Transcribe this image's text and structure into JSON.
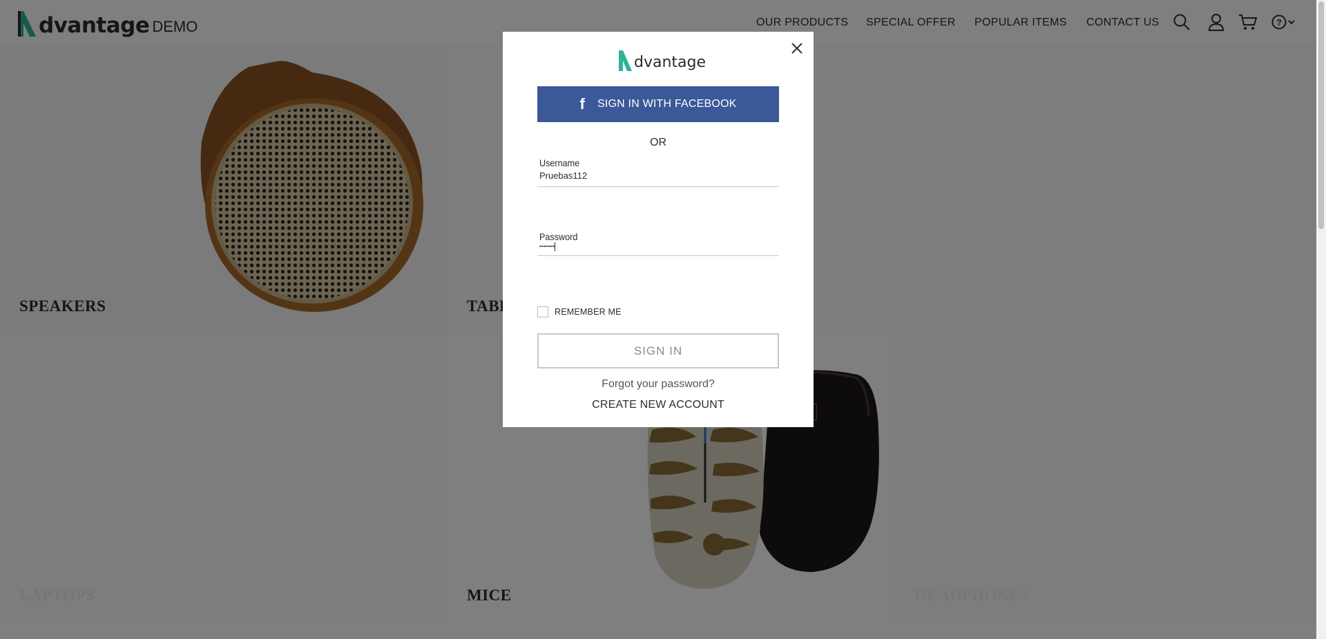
{
  "header": {
    "logo_text": "dvantage",
    "logo_suffix": "DEMO",
    "nav": [
      {
        "label": "OUR PRODUCTS"
      },
      {
        "label": "SPECIAL OFFER"
      },
      {
        "label": "POPULAR ITEMS"
      },
      {
        "label": "CONTACT US"
      }
    ],
    "icons": [
      "search-icon",
      "user-icon",
      "cart-icon",
      "help-icon",
      "chevron-down-icon"
    ]
  },
  "categories": {
    "speakers": "SPEAKERS",
    "tablets": "TABLETS",
    "laptops": "LAPTOPS",
    "mice": "MICE",
    "headphones": "HEADPHONES"
  },
  "login": {
    "logo_text": "dvantage",
    "facebook_label": "SIGN IN WITH FACEBOOK",
    "or_label": "OR",
    "username_label": "Username",
    "username_value": "Pruebas112",
    "password_label": "Password",
    "password_value": "••••••••",
    "remember_label": "REMEMBER ME",
    "signin_label": "SIGN IN",
    "forgot_label": "Forgot your password?",
    "create_label": "CREATE NEW ACCOUNT"
  },
  "colors": {
    "brand_green": "#2fb39b",
    "facebook_blue": "#3b5998",
    "overlay": "rgba(0,0,0,0.5)"
  }
}
